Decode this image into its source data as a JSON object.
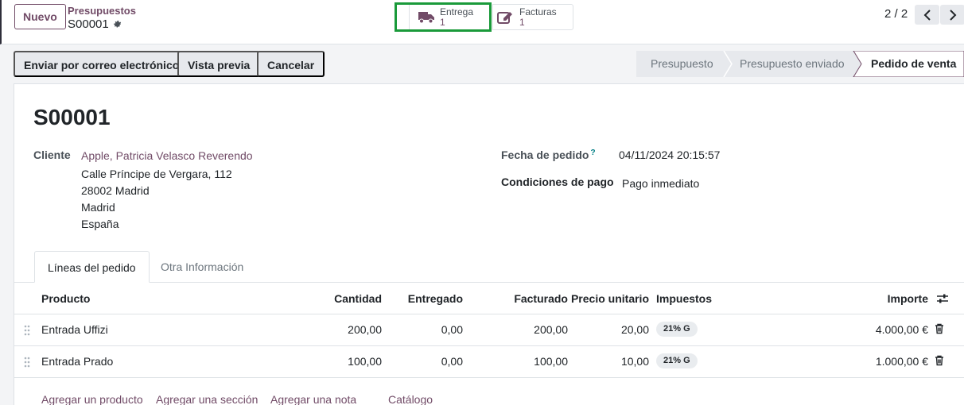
{
  "control_panel": {
    "new_button": "Nuevo",
    "breadcrumb_parent": "Presupuestos",
    "breadcrumb_current": "S00001",
    "pager": "2 / 2"
  },
  "smart_buttons": [
    {
      "label": "Entrega",
      "value": "1",
      "icon": "truck-icon"
    },
    {
      "label": "Facturas",
      "value": "1",
      "icon": "pencil-square-icon"
    }
  ],
  "actions": {
    "send_email": "Enviar por correo electrónico",
    "preview": "Vista previa",
    "cancel": "Cancelar"
  },
  "status_stages": [
    {
      "label": "Presupuesto",
      "active": false
    },
    {
      "label": "Presupuesto enviado",
      "active": false
    },
    {
      "label": "Pedido de venta",
      "active": true
    }
  ],
  "order": {
    "name": "S00001",
    "customer_label": "Cliente",
    "customer_name": "Apple, Patricia Velasco Reverendo",
    "address_lines": [
      "Calle Príncipe de Vergara, 112",
      "28002 Madrid",
      "Madrid",
      "España"
    ],
    "date_label": "Fecha de pedido",
    "date_help": "?",
    "date_value": "04/11/2024 20:15:57",
    "payment_label": "Condiciones de pago",
    "payment_value": "Pago inmediato"
  },
  "tabs": [
    "Líneas del pedido",
    "Otra Información"
  ],
  "lines_table": {
    "columns": [
      "Producto",
      "Cantidad",
      "Entregado",
      "Facturado",
      "Precio unitario",
      "Impuestos",
      "Importe"
    ],
    "rows": [
      {
        "product": "Entrada Uffizi",
        "qty": "200,00",
        "delivered": "0,00",
        "invoiced": "200,00",
        "unit_price": "20,00",
        "tax": "21% G",
        "amount": "4.000,00 €"
      },
      {
        "product": "Entrada Prado",
        "qty": "100,00",
        "delivered": "0,00",
        "invoiced": "100,00",
        "unit_price": "10,00",
        "tax": "21% G",
        "amount": "1.000,00 €"
      }
    ],
    "add_links": [
      "Agregar un producto",
      "Agregar una sección",
      "Agregar una nota",
      "Catálogo"
    ]
  },
  "colors": {
    "brand": "#714b67",
    "highlight": "#1a9a3a"
  }
}
